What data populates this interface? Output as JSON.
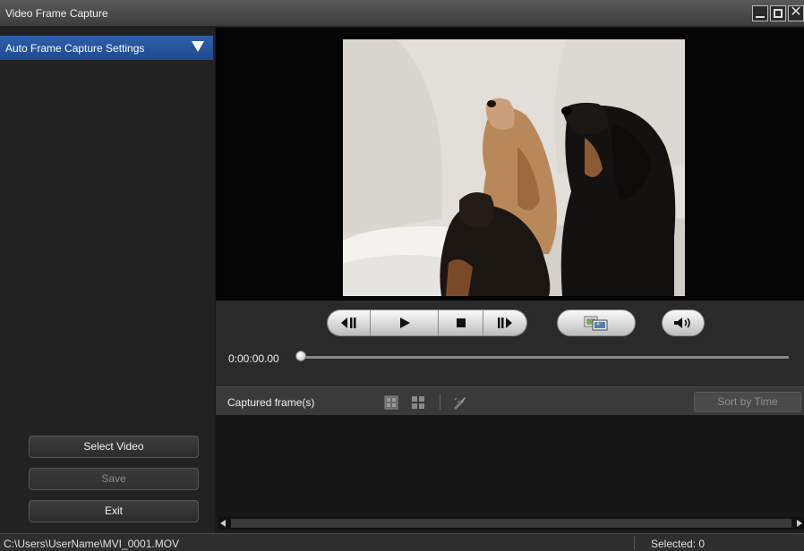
{
  "window": {
    "title": "Video Frame Capture"
  },
  "sidebar": {
    "settings_header": "Auto Frame Capture Settings",
    "buttons": {
      "select_video": "Select Video",
      "save": "Save",
      "exit": "Exit"
    }
  },
  "player": {
    "timecode": "0:00:00.00",
    "seek_position": 0
  },
  "captured": {
    "label": "Captured frame(s)",
    "sort_label": "Sort by Time"
  },
  "status": {
    "path": "C:\\Users\\UserName\\MVI_0001.MOV",
    "selected": "Selected: 0"
  },
  "colors": {
    "header_accent": "#2e5fab",
    "background": "#1b1b1b"
  }
}
